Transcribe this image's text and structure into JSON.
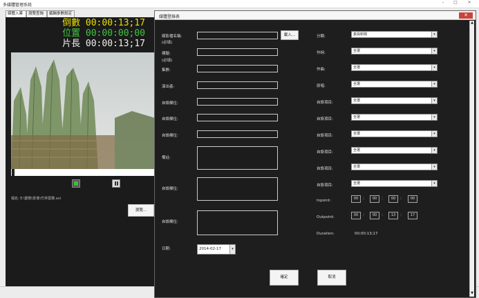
{
  "app": {
    "title": "多媒體管理系統"
  },
  "tabs": [
    "媒體入庫",
    "瀏覽查詢",
    "編輯參數設定"
  ],
  "player": {
    "countdown": "倒數 00:00:13;17",
    "position": "位置 00:00:00;00",
    "length": "片長 00:00:13;17",
    "filename": "檔名: E:\\動態\\影像\\竹林雲霧.avi",
    "browse": "瀏覽..."
  },
  "dialog": {
    "title": "媒體登錄表",
    "left": {
      "file_label": "媒影檔名稱:",
      "file_required": "(必填)",
      "import": "載入...",
      "title_label": "標題:",
      "title_required": "(必填)",
      "episode": "集數:",
      "performer": "演出者:",
      "custom1": "自設欄位:",
      "custom2": "自設欄位:",
      "custom3": "自設欄位:",
      "remarks": "備註:",
      "custom4": "自設欄位:",
      "custom5": "自設欄位:",
      "date_label": "日期:",
      "date_value": "2014-02-17"
    },
    "right": {
      "rows": [
        {
          "label": "分類:",
          "value": "委員新聞"
        },
        {
          "label": "作詞:",
          "value": "全選"
        },
        {
          "label": "作曲:",
          "value": "全選"
        },
        {
          "label": "原唱:",
          "value": "全選"
        },
        {
          "label": "自設項目:",
          "value": "全選"
        },
        {
          "label": "自設項目:",
          "value": "全選"
        },
        {
          "label": "自設項目:",
          "value": "全選"
        },
        {
          "label": "自設項目:",
          "value": "全選"
        },
        {
          "label": "自設項目:",
          "value": "全選"
        },
        {
          "label": "自設項目:",
          "value": "全選"
        }
      ],
      "inpoint_label": "Inpoint:",
      "inpoint": [
        "00",
        "00",
        "00",
        "00"
      ],
      "outpoint_label": "Outpoint:",
      "outpoint": [
        "00",
        "00",
        "13",
        "17"
      ],
      "duration_label": "Duration:",
      "duration": "00:00:13;17"
    },
    "ok": "確定",
    "cancel": "取消"
  },
  "colors": {
    "countdown": "#e8e000",
    "position": "#3ec93e",
    "length": "#f0f0f0",
    "dialog_bg": "#1e1e1e",
    "close": "#c9443a"
  }
}
